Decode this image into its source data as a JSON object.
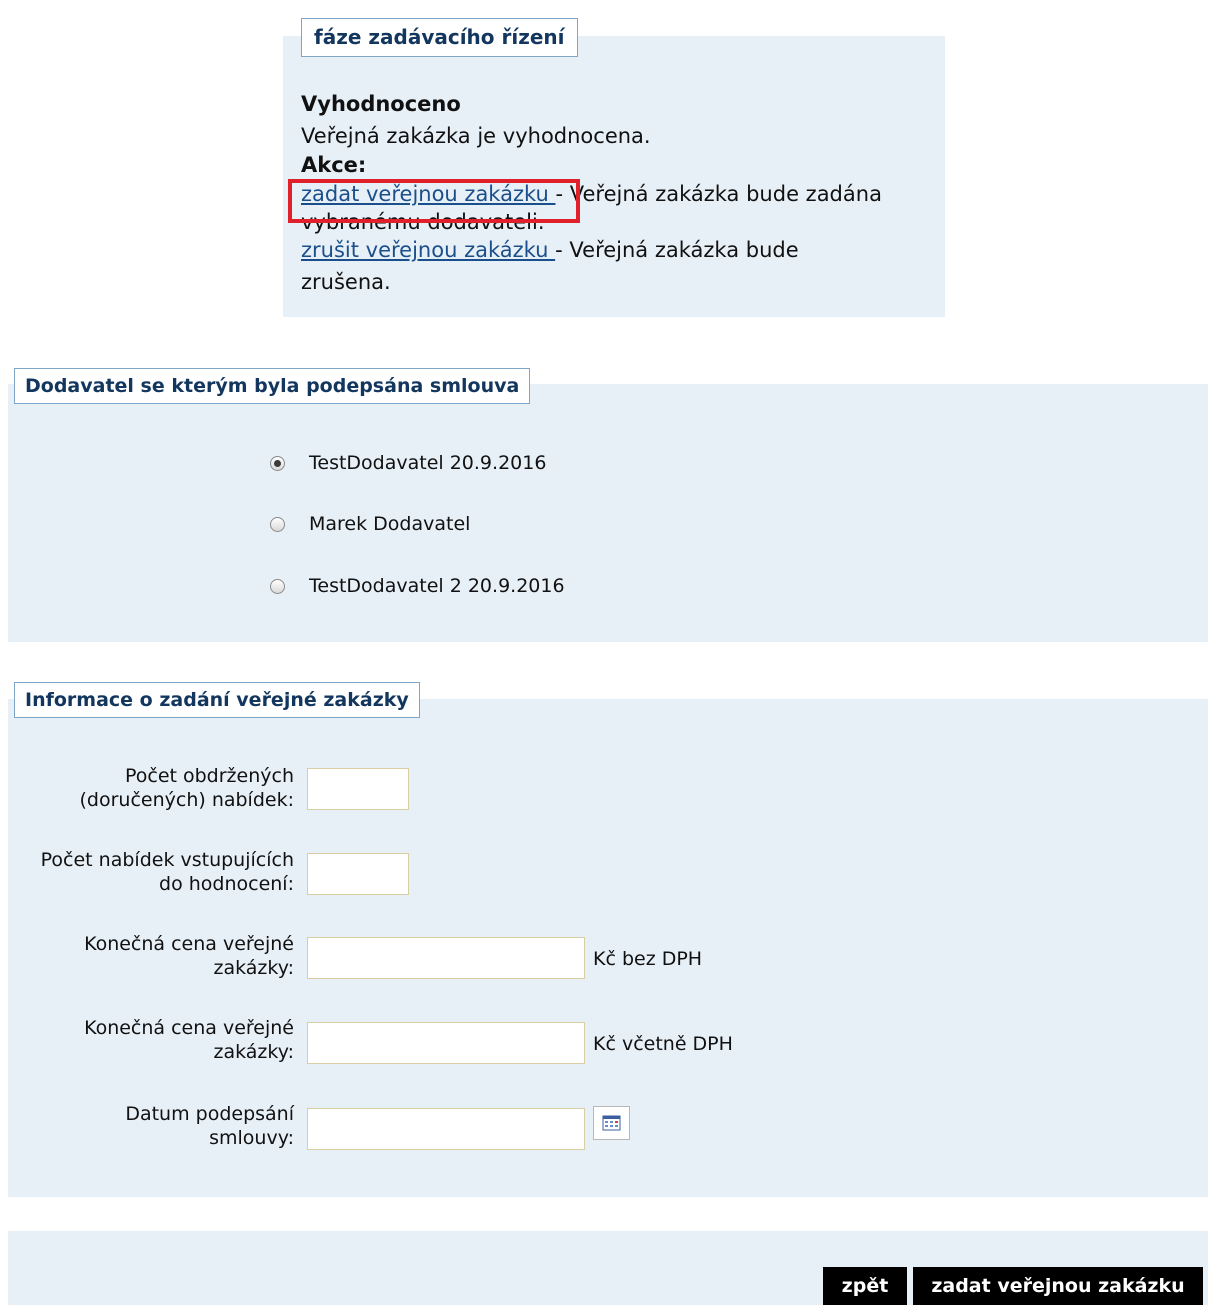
{
  "phase": {
    "legend": "fáze zadávacího řízení",
    "state_title": "Vyhodnoceno",
    "state_desc": "Veřejná zakázka je vyhodnocena.",
    "actions_label": "Akce:",
    "action1_link": "zadat veřejnou zakázku ",
    "action1_desc_line1": "- Veřejná zakázka bude zadána",
    "action1_desc_line2": "vybranému dodavateli.",
    "action2_link": "zrušit veřejnou zakázku ",
    "action2_desc_line1": "- Veřejná zakázka bude",
    "action2_desc_line2": "zrušena."
  },
  "supplier": {
    "legend": "Dodavatel se kterým byla podepsána smlouva",
    "options": [
      {
        "label": "TestDodavatel 20.9.2016",
        "checked": true
      },
      {
        "label": "Marek Dodavatel",
        "checked": false
      },
      {
        "label": "TestDodavatel 2 20.9.2016",
        "checked": false
      }
    ]
  },
  "info": {
    "legend": "Informace o zadání veřejné zakázky",
    "fields": [
      {
        "label_l1": "Počet obdržených",
        "label_l2": "(doručených) nabídek:",
        "value": "",
        "unit": ""
      },
      {
        "label_l1": "Počet nabídek vstupujících",
        "label_l2": "do hodnocení:",
        "value": "",
        "unit": ""
      },
      {
        "label_l1": "Konečná cena veřejné",
        "label_l2": "zakázky:",
        "value": "",
        "unit": "Kč bez DPH"
      },
      {
        "label_l1": "Konečná cena veřejné",
        "label_l2": "zakázky:",
        "value": "",
        "unit": "Kč včetně DPH"
      },
      {
        "label_l1": "Datum podepsání",
        "label_l2": "smlouvy:",
        "value": "",
        "unit": ""
      }
    ],
    "calendar_icon": "calendar-icon"
  },
  "buttons": {
    "back": "zpět",
    "submit": "zadat veřejnou zakázku"
  },
  "colors": {
    "panel": "#e8f0f7",
    "legend_border": "#7fa6c8",
    "highlight": "#e0202a",
    "button": "#000000"
  }
}
